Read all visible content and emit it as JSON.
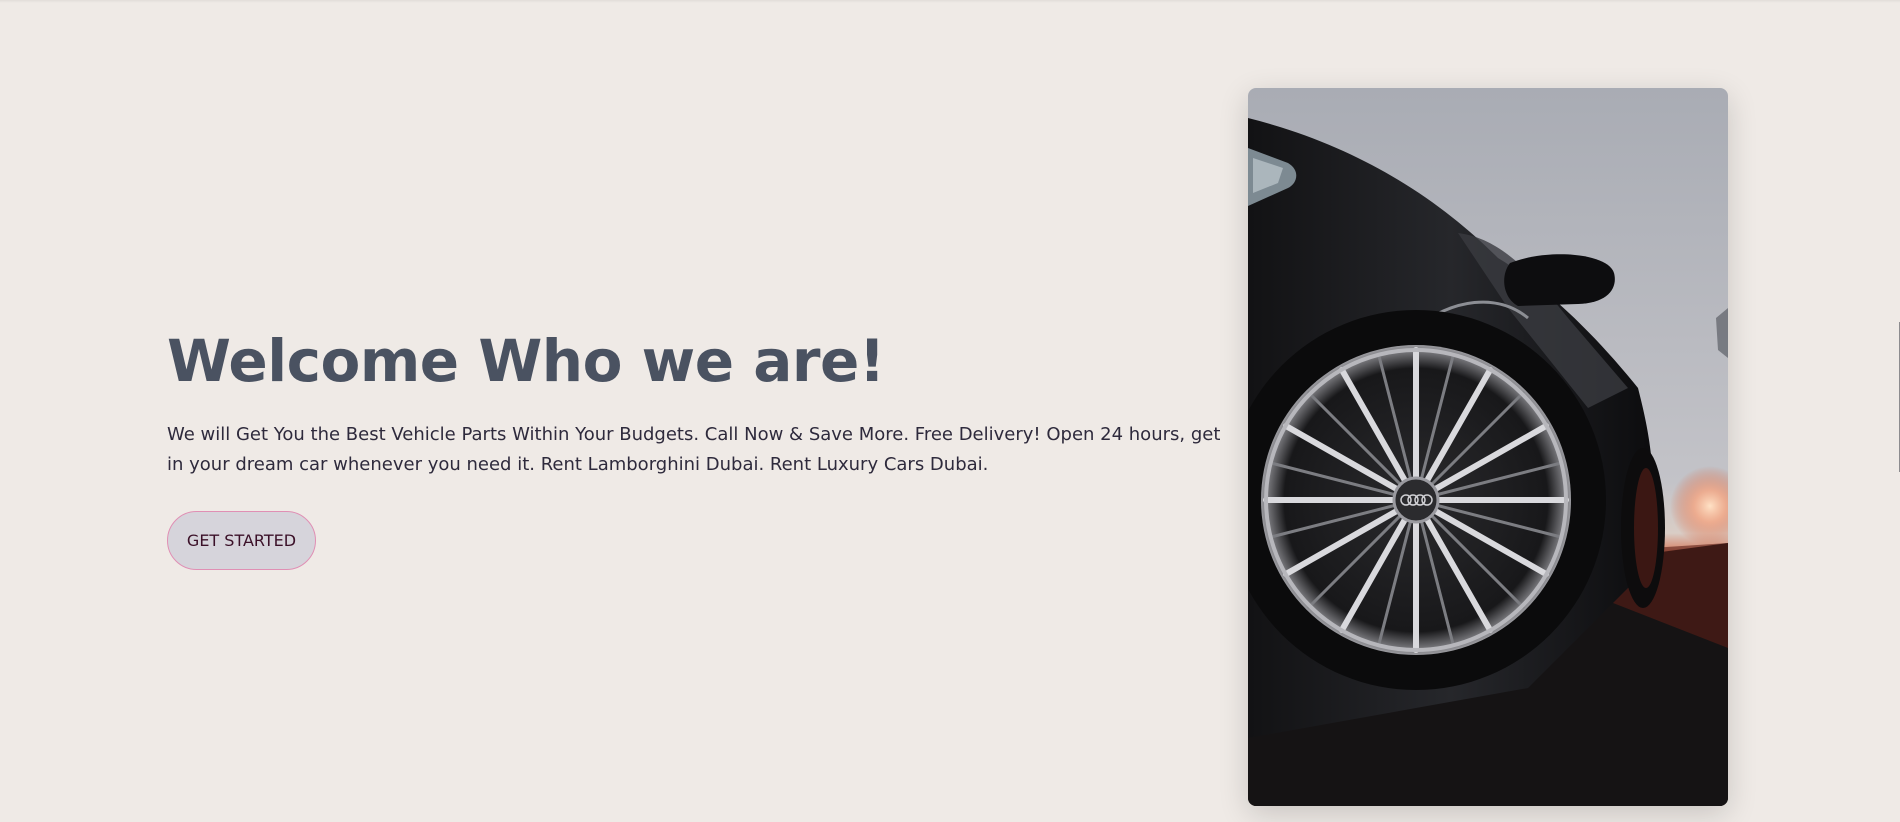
{
  "hero": {
    "title": "Welcome Who we are!",
    "description": "We will Get You the Best Vehicle Parts Within Your Budgets. Call Now & Save More. Free Delivery! Open 24 hours, get in your dream car whenever you need it. Rent Lamborghini Dubai. Rent Luxury Cars Dubai.",
    "cta_label": "GET STARTED"
  },
  "colors": {
    "background": "#efeae6",
    "title": "#4a5261",
    "text": "#2e2a3c",
    "button_bg": "#d6d4db",
    "button_border": "#e08fb4"
  },
  "image": {
    "subject": "black-car-front-wheel-at-sunset"
  }
}
